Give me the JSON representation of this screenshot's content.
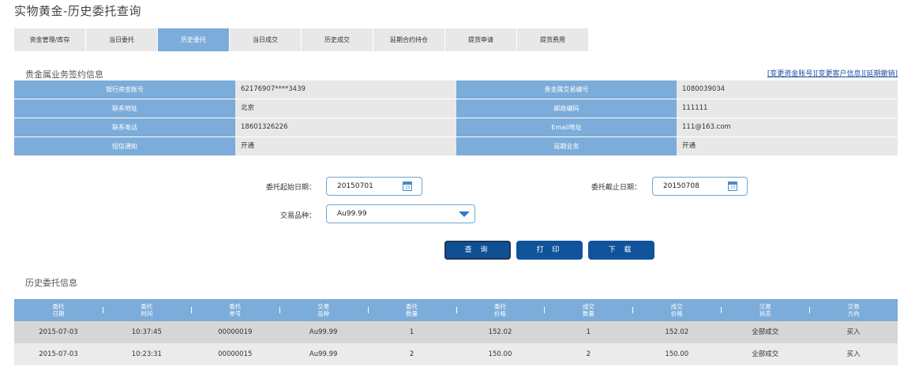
{
  "page": {
    "title": "实物黄金-历史委托查询"
  },
  "tabs": [
    {
      "label": "资金管理/库存",
      "active": false
    },
    {
      "label": "当日委托",
      "active": false
    },
    {
      "label": "历史委托",
      "active": true
    },
    {
      "label": "当日成交",
      "active": false
    },
    {
      "label": "历史成交",
      "active": false
    },
    {
      "label": "延期合约持仓",
      "active": false
    },
    {
      "label": "提货申请",
      "active": false
    },
    {
      "label": "提货费用",
      "active": false
    }
  ],
  "signing": {
    "title": "贵金属业务签约信息",
    "links": [
      "[变更资金账号]",
      "[变更客户信息]",
      "[延期撤销]"
    ],
    "rows": [
      {
        "l1": "银行资金账号",
        "v1": "62176907****3439",
        "l2": "贵金属交易编号",
        "v2": "1080039034"
      },
      {
        "l1": "联系地址",
        "v1": "北京",
        "l2": "邮政编码",
        "v2": "111111"
      },
      {
        "l1": "联系电话",
        "v1": "18601326226",
        "l2": "Email地址",
        "v2": "111@163.com"
      },
      {
        "l1": "短信通知",
        "v1": "开通",
        "l2": "延期业务",
        "v2": "开通"
      }
    ]
  },
  "filters": {
    "start_label": "委托起始日期：",
    "start_value": "20150701",
    "end_label": "委托截止日期：",
    "end_value": "20150708",
    "product_label": "交易品种：",
    "product_value": "Au99.99",
    "calendar_glyph": "23"
  },
  "buttons": {
    "query": "查 询",
    "print": "打 印",
    "download": "下 载"
  },
  "history": {
    "title": "历史委托信息",
    "columns": [
      [
        "委托",
        "日期"
      ],
      [
        "委托",
        "时间"
      ],
      [
        "委托",
        "单号"
      ],
      [
        "交易",
        "品种"
      ],
      [
        "委托",
        "数量"
      ],
      [
        "委托",
        "价格"
      ],
      [
        "成交",
        "数量"
      ],
      [
        "成交",
        "价格"
      ],
      [
        "交易",
        "状态"
      ],
      [
        "交易",
        "方向"
      ]
    ],
    "rows": [
      [
        "2015-07-03",
        "10:37:45",
        "00000019",
        "Au99.99",
        "1",
        "152.02",
        "1",
        "152.02",
        "全部成交",
        "买入"
      ],
      [
        "2015-07-03",
        "10:23:31",
        "00000015",
        "Au99.99",
        "2",
        "150.00",
        "2",
        "150.00",
        "全部成交",
        "买入"
      ]
    ]
  },
  "colors": {
    "accent": "#7cacd9",
    "button": "#10539b",
    "link": "#1a4fa0"
  },
  "icons": {
    "date_picker": "calendar-icon",
    "select": "dropdown-caret-icon"
  }
}
